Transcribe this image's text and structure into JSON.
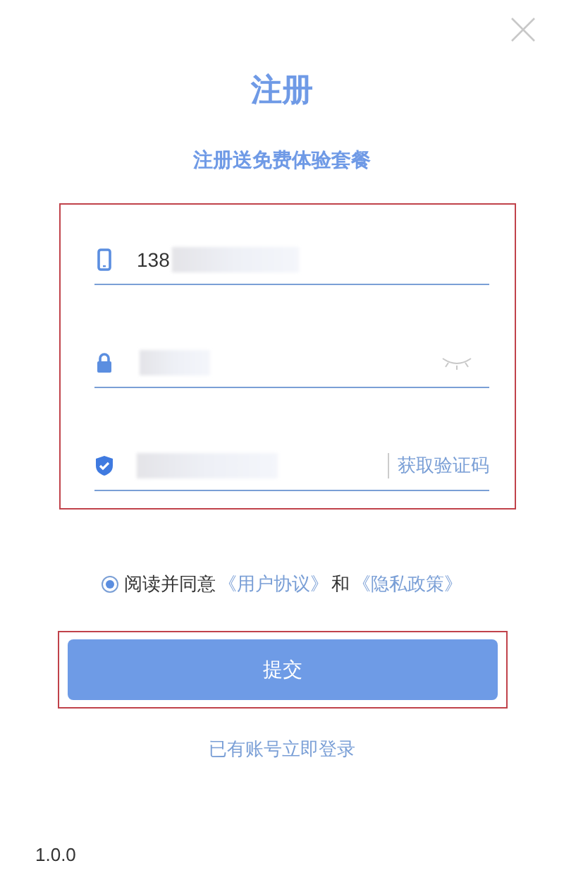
{
  "title": "注册",
  "subtitle": "注册送免费体验套餐",
  "fields": [
    {
      "kind": "phone",
      "value": "138"
    },
    {
      "kind": "password"
    },
    {
      "kind": "code",
      "action": "获取验证码"
    }
  ],
  "agreement": {
    "selected": true,
    "prefix": "阅读并同意",
    "link_1": "《用户协议》",
    "joiner": "和",
    "link_2": "《隐私政策》"
  },
  "submit": "提交",
  "login_link": "已有账号立即登录",
  "version": "1.0.0"
}
